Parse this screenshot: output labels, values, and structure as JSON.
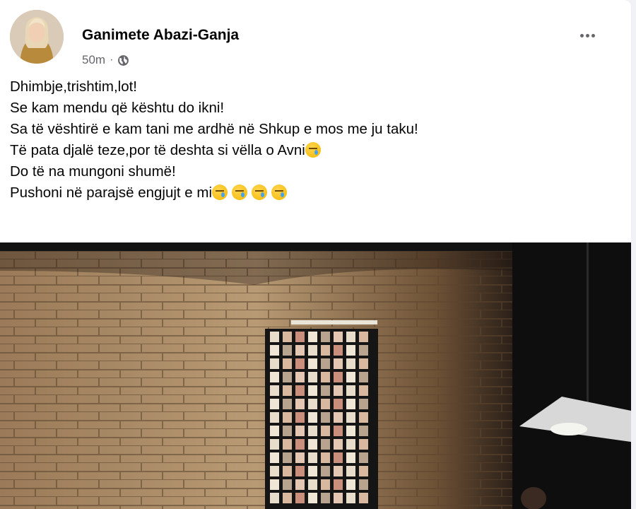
{
  "post": {
    "author": "Ganimete Abazi-Ganja",
    "time": "50m",
    "privacy_icon": "globe-icon",
    "more_icon": "more-options-icon",
    "lines": [
      {
        "text": "Dhimbje,trishtim,lot!",
        "emojis": 0
      },
      {
        "text": "Se kam mendu që kështu do ikni!",
        "emojis": 0
      },
      {
        "text": "Sa të vështirë e kam tani me ardhë në Shkup e mos me ju taku!",
        "emojis": 0
      },
      {
        "text": "Të pata djalë teze,por të deshta si vëlla o Avni",
        "emojis": 1
      },
      {
        "text": "Do të na mungoni shumë!",
        "emojis": 0
      },
      {
        "text": "Pushoni në parajsë engjujt e mi",
        "emojis": 4
      }
    ],
    "emoji_name": "sad-tear-emoji"
  },
  "colors": {
    "card_bg": "#ffffff",
    "page_bg": "#f0f2f5",
    "text_primary": "#050505",
    "text_secondary": "#65676b"
  }
}
